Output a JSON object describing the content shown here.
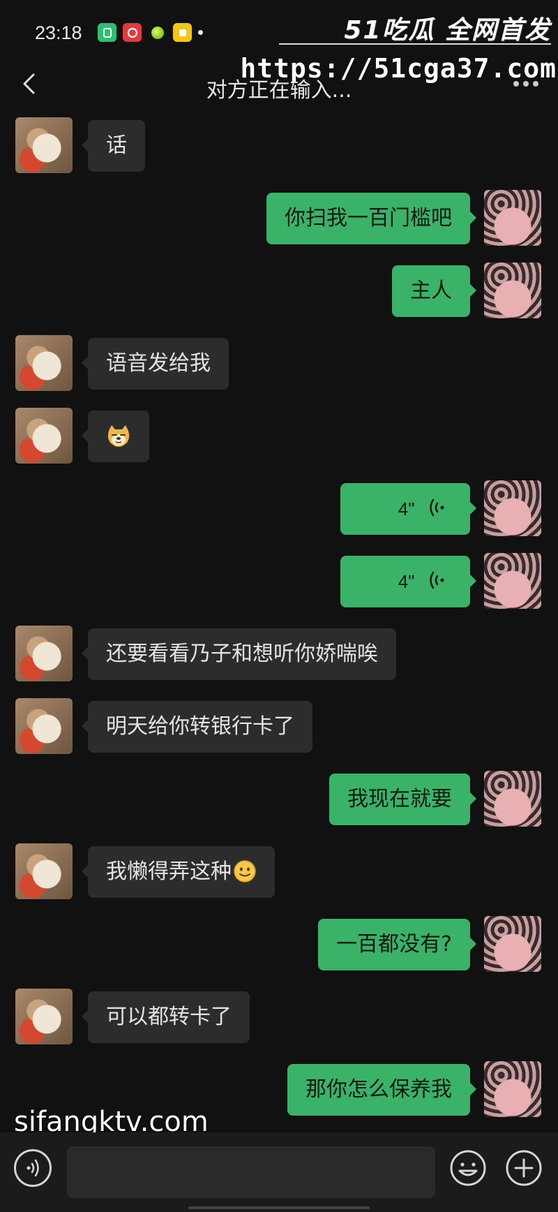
{
  "status": {
    "time": "23:18",
    "icons": [
      "app-green-icon",
      "netease-music-icon",
      "ball-app-icon",
      "notes-app-icon",
      "notification-dot-icon"
    ]
  },
  "watermark": {
    "logo": "51吃瓜 全网首发",
    "url": "https://51cga37.com",
    "bottom": "sifangktv.com"
  },
  "nav": {
    "title": "对方正在输入..."
  },
  "messages": [
    {
      "side": "in",
      "text": "话"
    },
    {
      "side": "out",
      "text": "你扫我一百门槛吧"
    },
    {
      "side": "out",
      "text": "主人"
    },
    {
      "side": "in",
      "text": "语音发给我"
    },
    {
      "side": "in",
      "emoji": "doge-emoji"
    },
    {
      "side": "out",
      "voice": "4\""
    },
    {
      "side": "out",
      "voice": "4\""
    },
    {
      "side": "in",
      "text": "还要看看乃子和想听你娇喘唉"
    },
    {
      "side": "in",
      "text": "明天给你转银行卡了"
    },
    {
      "side": "out",
      "text": "我现在就要"
    },
    {
      "side": "in",
      "text": "我懒得弄这种",
      "emoji": "smile-emoji"
    },
    {
      "side": "out",
      "text": "一百都没有?"
    },
    {
      "side": "in",
      "text": "可以都转卡了"
    },
    {
      "side": "out",
      "text": "那你怎么保养我"
    }
  ],
  "input": {
    "value": "",
    "placeholder": ""
  },
  "colors": {
    "background": "#111111",
    "incoming_bubble": "#2c2c2c",
    "outgoing_bubble": "#3ab368"
  }
}
